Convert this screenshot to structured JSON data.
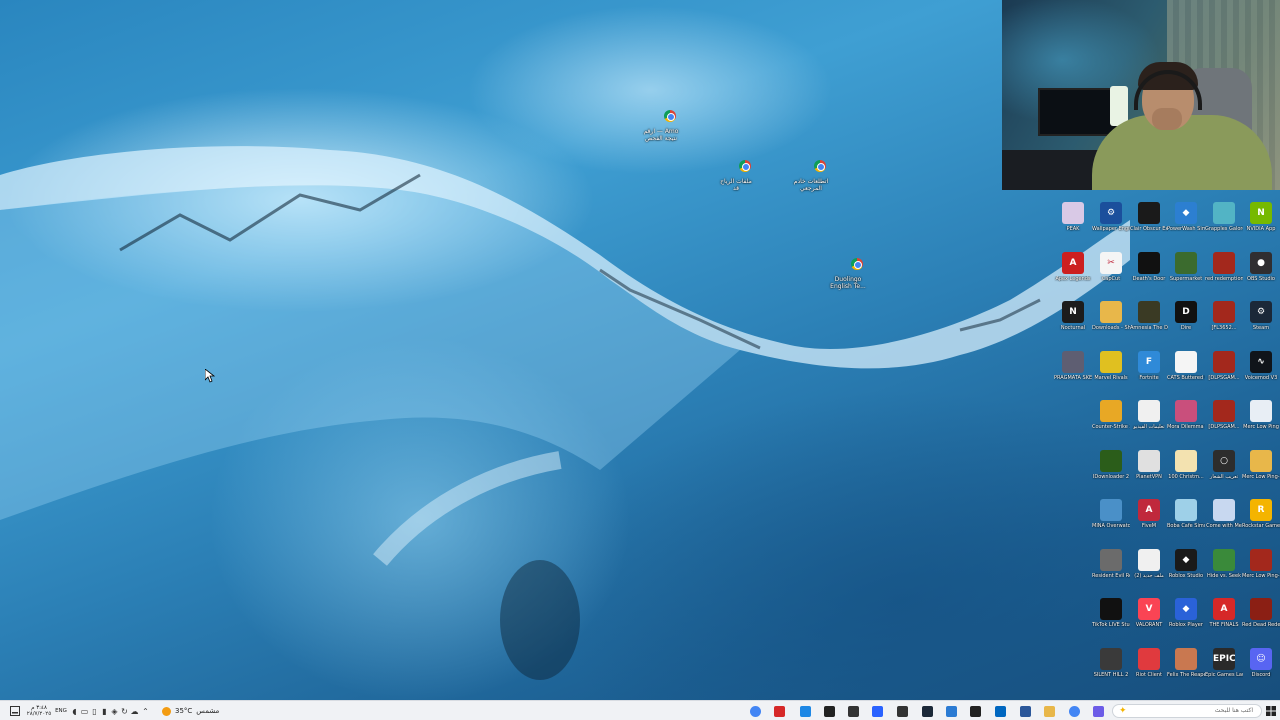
{
  "desktop": {
    "file_icons": [
      {
        "label": "ارقم — Amo\nنتيجة الفحص",
        "color": "#4285f4"
      },
      {
        "label": "ملفات الرياح\nقد",
        "color": "#4285f4"
      },
      {
        "label": "اتطلعات خادم\nالمرجعي",
        "color": "#4285f4"
      },
      {
        "label": "Duolingo\nEnglish Te...",
        "color": "#4285f4"
      }
    ],
    "grid_icons": [
      [
        {
          "label": "PEAK",
          "color": "#d9c9e6",
          "text": ""
        },
        {
          "label": "Wallpaper Engine",
          "color": "#1b4f9c",
          "text": "⚙"
        },
        {
          "label": "Clair Obscur Expedition 33",
          "color": "#1a1a1a",
          "text": ""
        },
        {
          "label": "PowerWash Simulator",
          "color": "#2c7fd1",
          "text": "◆"
        },
        {
          "label": "Grapples Galore",
          "color": "#52b4c5",
          "text": ""
        },
        {
          "label": "NVIDIA App",
          "color": "#76b900",
          "text": "N"
        }
      ],
      [
        {
          "label": "Apex Legends",
          "color": "#cc1f1f",
          "text": "A"
        },
        {
          "label": "CapCut",
          "color": "#f5f5f5",
          "text": "✂"
        },
        {
          "label": "Death's Door",
          "color": "#111111",
          "text": ""
        },
        {
          "label": "Supermarket",
          "color": "#3b6b2e",
          "text": ""
        },
        {
          "label": "red redemption 2",
          "color": "#a3281c",
          "text": ""
        },
        {
          "label": "OBS Studio",
          "color": "#302e31",
          "text": "●"
        }
      ],
      [
        {
          "label": "Nocturnal",
          "color": "#1c1c1c",
          "text": "N"
        },
        {
          "label": "Downloads - Shortcut",
          "color": "#e8b74a",
          "text": ""
        },
        {
          "label": "Amnesia The Dark Descent",
          "color": "#3a3a24",
          "text": ""
        },
        {
          "label": "Dire",
          "color": "#111111",
          "text": "D"
        },
        {
          "label": "[FL3652...",
          "color": "#a3281c",
          "text": ""
        },
        {
          "label": "Steam",
          "color": "#1b2838",
          "text": "⚙"
        }
      ],
      [
        {
          "label": "PRAGMATA SKETCHBOO...",
          "color": "#5e5e72",
          "text": ""
        },
        {
          "label": "Marvel Rivals",
          "color": "#e0c020",
          "text": ""
        },
        {
          "label": "Fortnite",
          "color": "#2f8ad8",
          "text": "F"
        },
        {
          "label": "CATS Buttered Cat",
          "color": "#f5f5f5",
          "text": ""
        },
        {
          "label": "[DLPSGAM...",
          "color": "#a3281c",
          "text": ""
        },
        {
          "label": "Voicemod V3",
          "color": "#10141a",
          "text": "∿"
        }
      ],
      [
        {
          "label": "Counter-Strike 2",
          "color": "#e8a825",
          "text": ""
        },
        {
          "label": "تعليمات الفيديو",
          "color": "#f0f0f0",
          "text": ""
        },
        {
          "label": "Mora Dilemma T...",
          "color": "#c94f7c",
          "text": ""
        },
        {
          "label": "[DLPSGAM...",
          "color": "#a3281c",
          "text": ""
        },
        {
          "label": "Merc Low Ping",
          "color": "#e8eef5",
          "text": ""
        }
      ],
      [
        {
          "label": "IDownloader 2",
          "color": "#2b5d1a",
          "text": ""
        },
        {
          "label": "PlanetVPN",
          "color": "#e0e0e0",
          "text": ""
        },
        {
          "label": "100 Christm...",
          "color": "#f3e2b0",
          "text": ""
        },
        {
          "label": "تعريب الشعار",
          "color": "#2d2d2d",
          "text": "○"
        },
        {
          "label": "Merc Low Ping-2025",
          "color": "#e8b74a",
          "text": ""
        }
      ],
      [
        {
          "label": "MINA Overwatch",
          "color": "#4a90c8",
          "text": ""
        },
        {
          "label": "FiveM",
          "color": "#c0283c",
          "text": "A"
        },
        {
          "label": "Boba Cafe Simulat...",
          "color": "#9ed0e8",
          "text": ""
        },
        {
          "label": "Come with Me",
          "color": "#c8d8f0",
          "text": ""
        },
        {
          "label": "Rockstar Games",
          "color": "#f4b400",
          "text": "R"
        }
      ],
      [
        {
          "label": "Resident Evil Requiem",
          "color": "#6b6b6b",
          "text": ""
        },
        {
          "label": "ملف جديد (2)",
          "color": "#f0f0f0",
          "text": ""
        },
        {
          "label": "Roblox Studio",
          "color": "#1a1a1a",
          "text": "◆"
        },
        {
          "label": "Hide vs. Seek",
          "color": "#3a8a3a",
          "text": ""
        },
        {
          "label": "Merc Low Ping-2025",
          "color": "#a3281c",
          "text": ""
        }
      ],
      [
        {
          "label": "TikTok LIVE Studio",
          "color": "#111111",
          "text": ""
        },
        {
          "label": "VALORANT",
          "color": "#fa4454",
          "text": "V"
        },
        {
          "label": "Roblox Player",
          "color": "#2a62d8",
          "text": "◆"
        },
        {
          "label": "THE FINALS",
          "color": "#d62828",
          "text": "A"
        },
        {
          "label": "Red Dead Redempti...",
          "color": "#8b1f14",
          "text": ""
        }
      ],
      [
        {
          "label": "SILENT HILL 2",
          "color": "#3a3a3a",
          "text": ""
        },
        {
          "label": "Riot Client",
          "color": "#e03a3e",
          "text": ""
        },
        {
          "label": "Felix The Reaper",
          "color": "#c97850",
          "text": ""
        },
        {
          "label": "Epic Games Launcher",
          "color": "#2a2a2a",
          "text": "EPIC"
        },
        {
          "label": "Discord",
          "color": "#5865f2",
          "text": "☺"
        }
      ]
    ]
  },
  "taskbar": {
    "clock_time": "٣:٤٨ م",
    "clock_date": "٢٨/٧/٢٠٢٥",
    "language": "ENG",
    "weather_temp": "35°C",
    "weather_desc": "مشمس",
    "search_placeholder": "اكتب هنا للبحث",
    "apps": [
      {
        "name": "chrome",
        "color": "#4285f4"
      },
      {
        "name": "recorder",
        "color": "#d62828"
      },
      {
        "name": "edge",
        "color": "#1e88e5"
      },
      {
        "name": "capcut",
        "color": "#222222"
      },
      {
        "name": "snip",
        "color": "#333333"
      },
      {
        "name": "media",
        "color": "#2962ff"
      },
      {
        "name": "obs",
        "color": "#333333"
      },
      {
        "name": "steam",
        "color": "#1b2838"
      },
      {
        "name": "vscode",
        "color": "#2b7bd3"
      },
      {
        "name": "terminal",
        "color": "#222222"
      },
      {
        "name": "store",
        "color": "#0067c0"
      },
      {
        "name": "explorer-doc",
        "color": "#2b579a"
      },
      {
        "name": "folder",
        "color": "#e8b74a"
      },
      {
        "name": "chrome-2",
        "color": "#4285f4"
      },
      {
        "name": "copilot",
        "color": "#6c5ce7"
      }
    ]
  }
}
